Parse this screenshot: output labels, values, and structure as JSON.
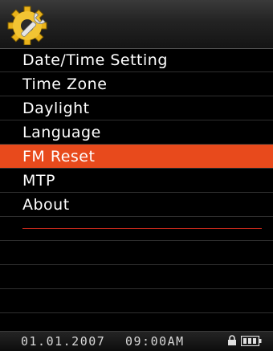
{
  "header": {
    "icon": "settings-gear-wrench-icon"
  },
  "menu": {
    "items": [
      {
        "label": "Date/Time Setting",
        "selected": false
      },
      {
        "label": "Time Zone",
        "selected": false
      },
      {
        "label": "Daylight",
        "selected": false
      },
      {
        "label": "Language",
        "selected": false
      },
      {
        "label": "FM Reset",
        "selected": true
      },
      {
        "label": "MTP",
        "selected": false
      },
      {
        "label": "About",
        "selected": false
      }
    ]
  },
  "statusbar": {
    "date": "01.01.2007",
    "time": "09:00AM",
    "lock_icon": "lock-icon",
    "battery_icon": "battery-icon"
  },
  "colors": {
    "selection": "#e84a1c",
    "divider": "#c0281a",
    "text": "#ffffff"
  }
}
